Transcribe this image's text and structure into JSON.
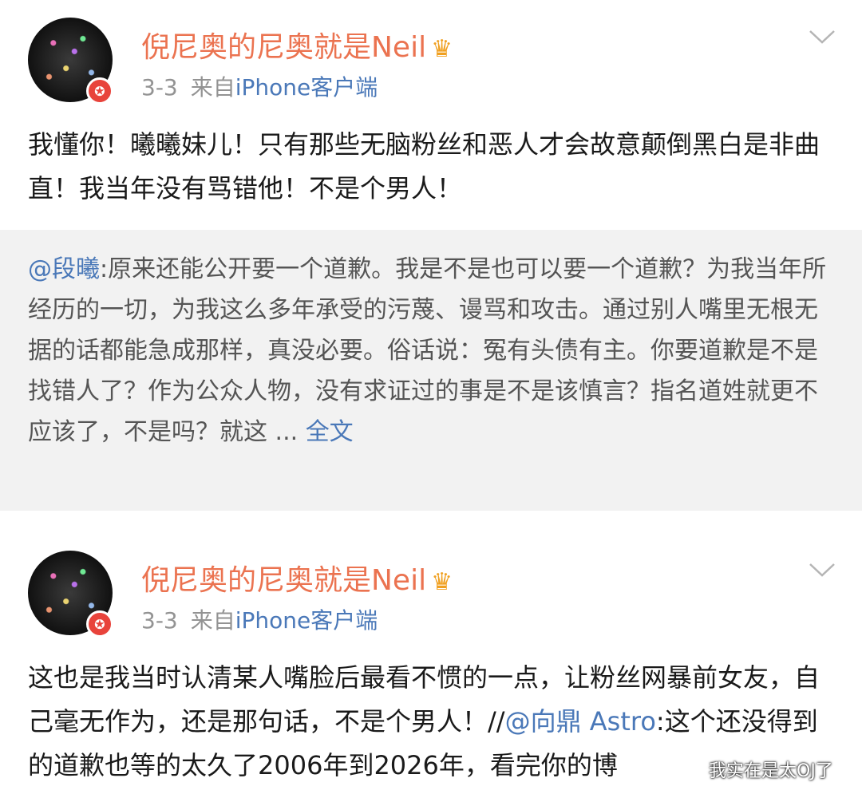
{
  "posts": [
    {
      "username": "倪尼奥的尼奥就是Neil",
      "crown": "♛",
      "date": "3-3",
      "source_prefix": "来自",
      "source": "iPhone客户端",
      "text": "我懂你！曦曦妹儿！只有那些无脑粉丝和恶人才会故意颠倒黑白是非曲直！我当年没有骂错他！不是个男人！"
    },
    {
      "username": "倪尼奥的尼奥就是Neil",
      "crown": "♛",
      "date": "3-3",
      "source_prefix": "来自",
      "source": "iPhone客户端",
      "text_before": "这也是我当时认清某人嘴脸后最看不惯的一点，让粉丝网暴前女友，自己毫无作为，还是那句话，不是个男人！//",
      "mention": "@向鼎 Astro",
      "text_after": ":这个还没得到的道歉也等的太久了2006年到2026年，看完你的博"
    }
  ],
  "quote": {
    "mention": "@段曦",
    "text": ":原来还能公开要一个道歉。我是不是也可以要一个道歉？为我当年所经历的一切，为我这么多年承受的污蔑、谩骂和攻击。通过别人嘴里无根无据的话都能急成那样，真没必要。俗话说：冤有头债有主。你要道歉是不是找错人了？作为公众人物，没有求证过的事是不是该慎言？指名道姓就更不应该了，不是吗？就这 ... ",
    "full_text_link": "全文"
  },
  "watermark": "我实在是太OJ了",
  "colors": {
    "username": "#eb7350",
    "link": "#4a78b8",
    "meta": "#939393",
    "quote_bg": "#f2f2f2",
    "verified_badge": "#e8433b"
  },
  "icons": [
    "avatar",
    "verified-badge-icon",
    "crown-icon",
    "chevron-down-icon"
  ]
}
